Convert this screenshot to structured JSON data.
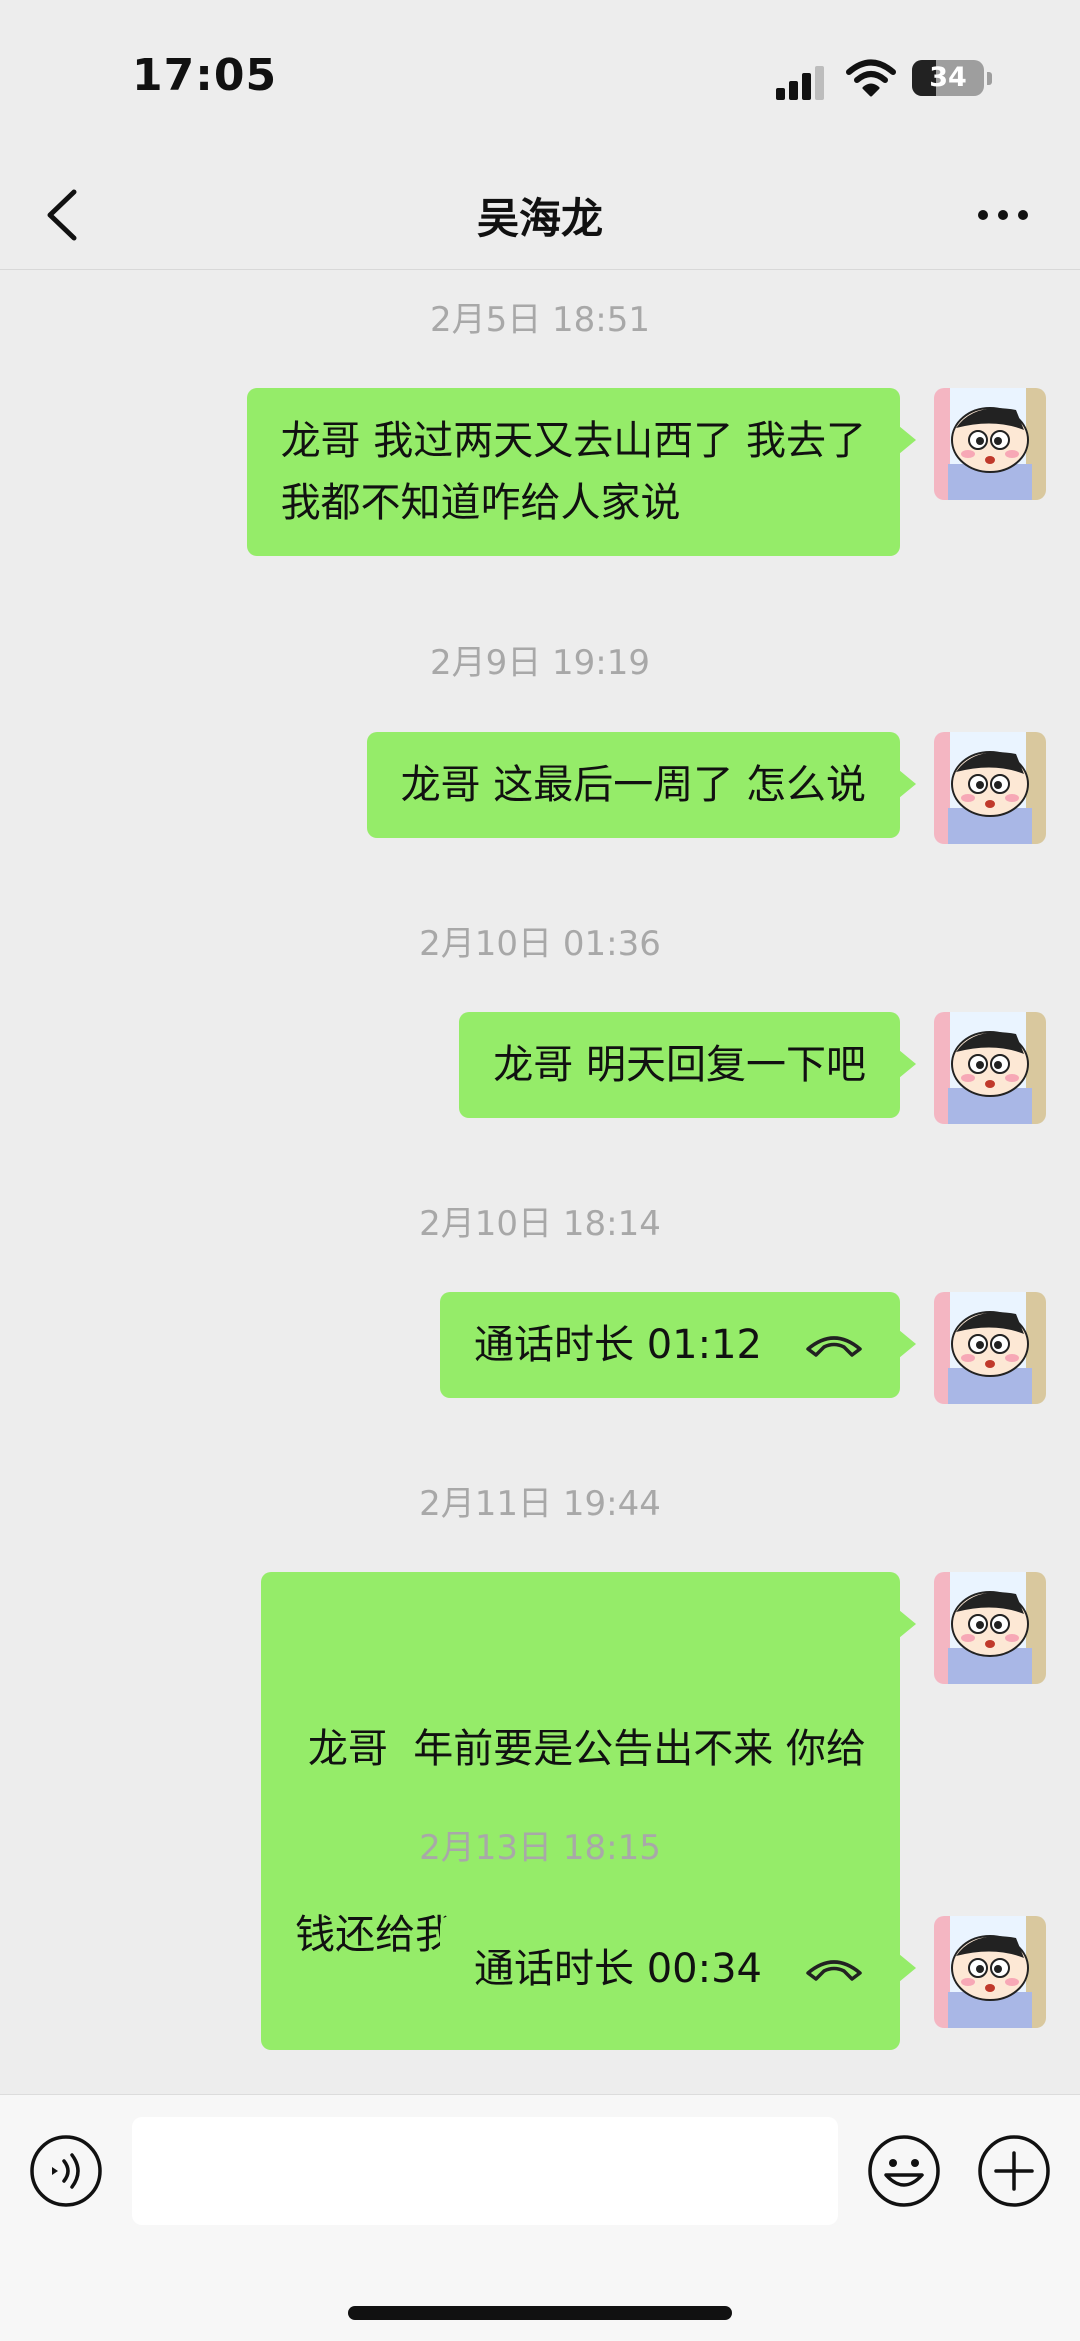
{
  "status_bar": {
    "time": "17:05",
    "battery_level": "34",
    "icons": [
      "cellular-signal-icon",
      "wifi-icon",
      "battery-icon"
    ]
  },
  "nav": {
    "back_icon": "chevron-left-icon",
    "title": "吴海龙",
    "more_icon": "ellipsis-icon"
  },
  "messages": [
    {
      "timestamp": "2月5日 18:51",
      "lines": [
        "龙哥 我过两天又去山西了  我去了",
        "我都不知道咋给人家说"
      ]
    },
    {
      "timestamp": "2月9日 19:19",
      "lines": [
        "龙哥 这最后一周了 怎么说"
      ]
    },
    {
      "timestamp": "2月10日 01:36",
      "lines": [
        "龙哥 明天回复一下吧"
      ]
    },
    {
      "timestamp": "2月10日 18:14",
      "call_text": "通话时长 01:12",
      "icon": "phone-hangup-icon"
    },
    {
      "timestamp": "2月11日 19:44",
      "lines": [
        " 龙哥  年前要是公告出不来 你给",
        "钱还给我吧"
      ]
    },
    {
      "timestamp": "2月13日 18:15",
      "call_text": "通话时长 00:34",
      "icon": "phone-hangup-icon"
    }
  ],
  "input_bar": {
    "voice_icon": "voice-input-icon",
    "input_value": "",
    "emoji_icon": "emoji-icon",
    "plus_icon": "plus-circle-icon"
  },
  "colors": {
    "background": "#ededed",
    "bubble_green": "#95ec69",
    "timestamp_gray": "#a8a8a8"
  }
}
